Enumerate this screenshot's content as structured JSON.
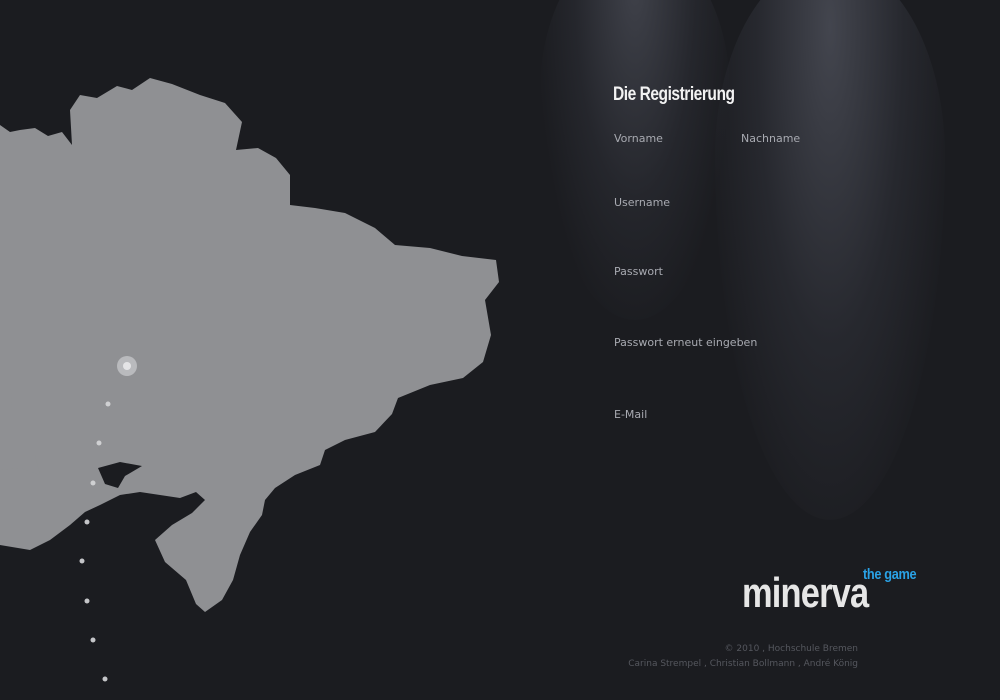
{
  "form": {
    "title": "Die Registrierung",
    "fields": {
      "vorname": {
        "label": "Vorname",
        "value": ""
      },
      "nachname": {
        "label": "Nachname",
        "value": ""
      },
      "username": {
        "label": "Username",
        "value": ""
      },
      "passwort": {
        "label": "Passwort",
        "value": ""
      },
      "passwort2": {
        "label": "Passwort erneut eingeben",
        "value": ""
      },
      "email": {
        "label": "E-Mail",
        "value": ""
      }
    }
  },
  "logo": {
    "name": "minerva",
    "tagline": "the game"
  },
  "footer": {
    "copyright": "© 2010 , Hochschule Bremen",
    "authors": "Carina Strempel , Christian Bollmann ,  André König"
  },
  "colors": {
    "background": "#1b1c20",
    "map_land": "#8f9093",
    "accent": "#2aa2e6"
  },
  "map": {
    "icons": [
      "location-marker-icon",
      "path-dot-icon"
    ]
  }
}
